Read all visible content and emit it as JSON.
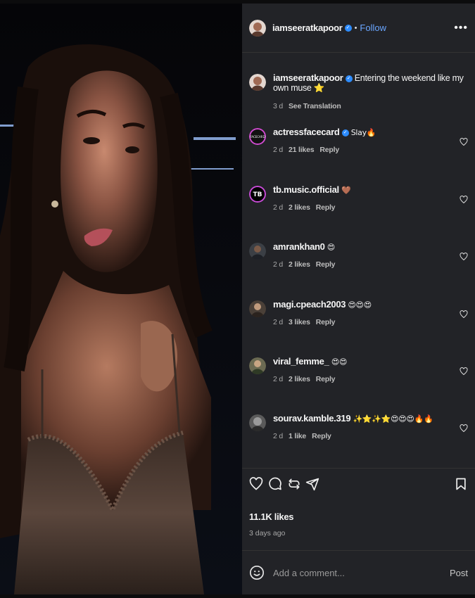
{
  "post": {
    "author": "iamseeratkapoor",
    "follow_label": "Follow",
    "more_label": "•••",
    "bullet": "•"
  },
  "caption": {
    "username": "iamseeratkapoor",
    "text": "Entering the weekend like my own muse ⭐",
    "time": "3 d",
    "translation": "See Translation"
  },
  "comments": [
    {
      "username": "actressfacecard",
      "verified": true,
      "text": "Slay🔥",
      "time": "2 d",
      "likes": "21 likes",
      "reply": "Reply"
    },
    {
      "username": "tb.music.official",
      "verified": false,
      "text": "🤎",
      "time": "2 d",
      "likes": "2 likes",
      "reply": "Reply"
    },
    {
      "username": "amrankhan0",
      "verified": false,
      "text": "😍",
      "time": "2 d",
      "likes": "2 likes",
      "reply": "Reply"
    },
    {
      "username": "magi.cpeach2003",
      "verified": false,
      "text": "😍😍😍",
      "time": "2 d",
      "likes": "3 likes",
      "reply": "Reply"
    },
    {
      "username": "viral_femme_",
      "verified": false,
      "text": "😍😍",
      "time": "2 d",
      "likes": "2 likes",
      "reply": "Reply"
    },
    {
      "username": "sourav.kamble.319",
      "verified": false,
      "text": "✨⭐✨⭐😍😍😍🔥🔥",
      "time": "2 d",
      "likes": "1 like",
      "reply": "Reply"
    }
  ],
  "stats": {
    "likes": "11.1K likes",
    "posted": "3 days ago"
  },
  "composer": {
    "placeholder": "Add a comment...",
    "post_label": "Post"
  },
  "colors": {
    "panel_bg": "#222327",
    "link": "#6aa6ff",
    "verified": "#2d8cff"
  },
  "icons": [
    "heart-icon",
    "comment-icon",
    "share-icon",
    "repost-icon",
    "bookmark-icon",
    "emoji-icon",
    "more-icon",
    "verified-icon"
  ]
}
